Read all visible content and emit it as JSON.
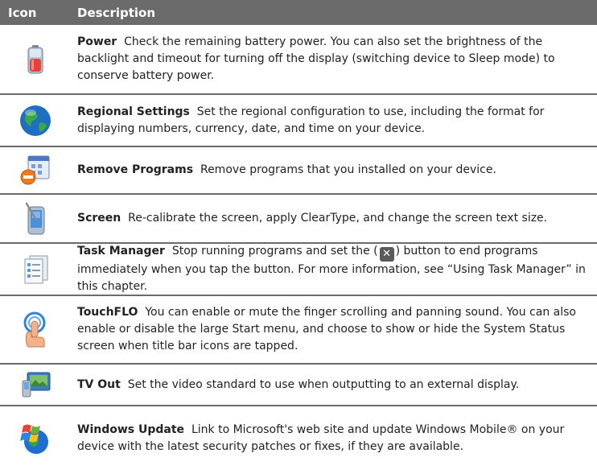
{
  "header": {
    "icon": "Icon",
    "description": "Description"
  },
  "rows": [
    {
      "icon": "battery-icon",
      "title": "Power",
      "text": "Check the remaining battery power. You can also set the brightness of the backlight and timeout for turning off the display (switching device to Sleep mode) to conserve battery power."
    },
    {
      "icon": "globe-icon",
      "title": "Regional Settings",
      "text": "Set the regional configuration to use, including the format for displaying numbers, currency, date, and time on your device."
    },
    {
      "icon": "remove-programs-icon",
      "title": "Remove Programs",
      "text": "Remove programs that you installed on your device."
    },
    {
      "icon": "screen-stylus-icon",
      "title": "Screen",
      "text": "Re-calibrate the screen, apply ClearType, and change the screen text size."
    },
    {
      "icon": "task-manager-icon",
      "title": "Task Manager",
      "text_before": "Stop running programs and set the (",
      "inline_button": "✕",
      "text_after": ") button to end programs immediately when you tap the button. For more information, see “Using Task Manager” in this chapter."
    },
    {
      "icon": "touchflo-icon",
      "title": "TouchFLO",
      "text": "You can enable or mute the finger scrolling and panning sound. You can also enable or disable the large Start menu, and choose to show or hide the System Status screen when title bar icons are tapped."
    },
    {
      "icon": "tv-out-icon",
      "title": "TV Out",
      "text": "Set the video standard to use when outputting to an external display."
    },
    {
      "icon": "windows-update-icon",
      "title": "Windows Update",
      "text": "Link to Microsoft's web site and update Windows Mobile® on your device with the latest security patches or fixes, if they are available."
    }
  ]
}
